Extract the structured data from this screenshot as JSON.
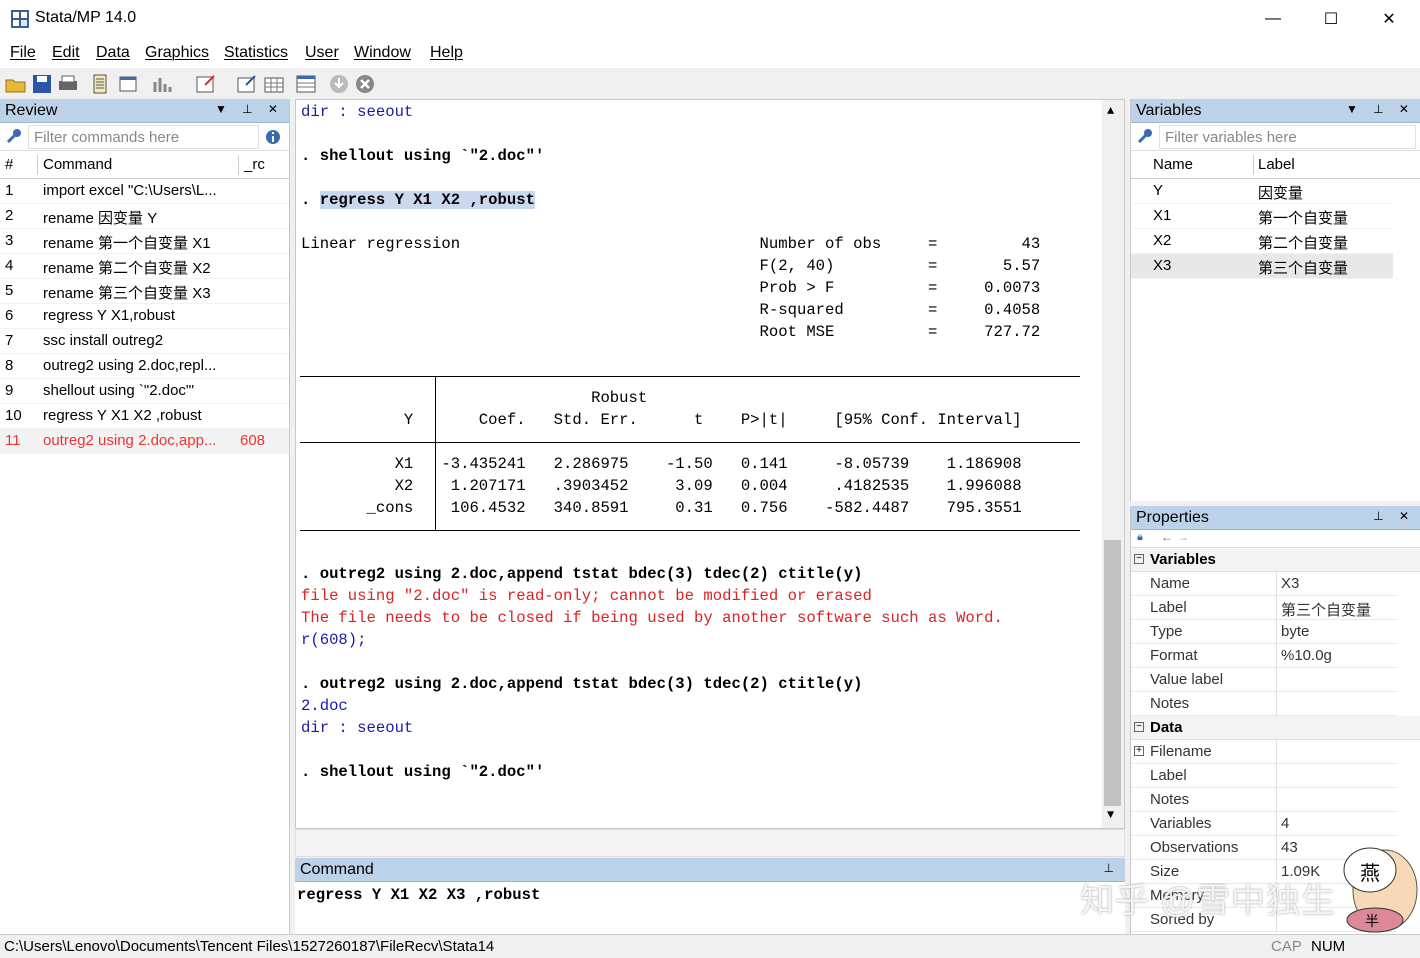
{
  "window": {
    "title": "Stata/MP 14.0",
    "min": "—",
    "max": "☐",
    "close": "✕"
  },
  "menu": [
    "File",
    "Edit",
    "Data",
    "Graphics",
    "Statistics",
    "User",
    "Window",
    "Help"
  ],
  "review": {
    "title": "Review",
    "filter_placeholder": "Filter commands here",
    "col_num": "#",
    "col_command": "Command",
    "col_rc": "_rc",
    "rows": [
      {
        "n": "1",
        "cmd": "import excel \"C:\\Users\\L...",
        "rc": "",
        "error": false
      },
      {
        "n": "2",
        "cmd": "rename 因变量 Y",
        "rc": "",
        "error": false
      },
      {
        "n": "3",
        "cmd": "rename 第一个自变量 X1",
        "rc": "",
        "error": false
      },
      {
        "n": "4",
        "cmd": "rename 第二个自变量 X2",
        "rc": "",
        "error": false
      },
      {
        "n": "5",
        "cmd": "rename 第三个自变量 X3",
        "rc": "",
        "error": false
      },
      {
        "n": "6",
        "cmd": "regress Y X1,robust",
        "rc": "",
        "error": false
      },
      {
        "n": "7",
        "cmd": "ssc install outreg2",
        "rc": "",
        "error": false
      },
      {
        "n": "8",
        "cmd": "outreg2 using 2.doc,repl...",
        "rc": "",
        "error": false
      },
      {
        "n": "9",
        "cmd": "shellout using `\"2.doc\"'",
        "rc": "",
        "error": false
      },
      {
        "n": "10",
        "cmd": "regress Y X1 X2 ,robust",
        "rc": "",
        "error": false
      },
      {
        "n": "11",
        "cmd": "outreg2 using 2.doc,app...",
        "rc": "608",
        "error": true
      }
    ]
  },
  "results": {
    "lines": [
      {
        "text": "dir : seeout",
        "cls": "blue"
      },
      {
        "text": "",
        "cls": ""
      },
      {
        "text": ". shellout using `\"2.doc\"'",
        "cls": "bold"
      },
      {
        "text": "",
        "cls": ""
      },
      {
        "text": ". regress Y X1 X2 ,robust",
        "cls": "bold hl"
      },
      {
        "text": "",
        "cls": ""
      },
      {
        "text": "Linear regression                                Number of obs     =         43",
        "cls": ""
      },
      {
        "text": "                                                 F(2, 40)          =       5.57",
        "cls": ""
      },
      {
        "text": "                                                 Prob > F          =     0.0073",
        "cls": ""
      },
      {
        "text": "                                                 R-squared         =     0.4058",
        "cls": ""
      },
      {
        "text": "                                                 Root MSE          =     727.72",
        "cls": ""
      },
      {
        "text": "",
        "cls": ""
      },
      {
        "text": "",
        "cls": ""
      },
      {
        "text": "                               Robust",
        "cls": ""
      },
      {
        "text": "           Y       Coef.   Std. Err.      t    P>|t|     [95% Conf. Interval]",
        "cls": ""
      },
      {
        "text": "",
        "cls": ""
      },
      {
        "text": "          X1   -3.435241   2.286975    -1.50   0.141     -8.05739    1.186908",
        "cls": ""
      },
      {
        "text": "          X2    1.207171   .3903452     3.09   0.004     .4182535    1.996088",
        "cls": ""
      },
      {
        "text": "       _cons    106.4532   340.8591     0.31   0.756    -582.4487    795.3551",
        "cls": ""
      },
      {
        "text": "",
        "cls": ""
      },
      {
        "text": "",
        "cls": ""
      },
      {
        "text": ". outreg2 using 2.doc,append tstat bdec(3) tdec(2) ctitle(y)",
        "cls": "bold"
      },
      {
        "text": "file using \"2.doc\" is read-only; cannot be modified or erased",
        "cls": "red"
      },
      {
        "text": "The file needs to be closed if being used by another software such as Word.",
        "cls": "red"
      },
      {
        "text": "r(608);",
        "cls": "blue"
      },
      {
        "text": "",
        "cls": ""
      },
      {
        "text": ". outreg2 using 2.doc,append tstat bdec(3) tdec(2) ctitle(y)",
        "cls": "bold"
      },
      {
        "text": "2.doc",
        "cls": "blue"
      },
      {
        "text": "dir : seeout",
        "cls": "blue"
      },
      {
        "text": "",
        "cls": ""
      },
      {
        "text": ". shellout using `\"2.doc\"'",
        "cls": "bold"
      },
      {
        "text": "",
        "cls": ""
      },
      {
        "text": "",
        "cls": ""
      },
      {
        "text": ".",
        "cls": ""
      }
    ]
  },
  "command": {
    "title": "Command",
    "value": "regress Y X1 X2 X3 ,robust"
  },
  "variables": {
    "title": "Variables",
    "filter_placeholder": "Filter variables here",
    "col_name": "Name",
    "col_label": "Label",
    "rows": [
      {
        "name": "Y",
        "label": "因变量"
      },
      {
        "name": "X1",
        "label": "第一个自变量"
      },
      {
        "name": "X2",
        "label": "第二个自变量"
      },
      {
        "name": "X3",
        "label": "第三个自变量"
      }
    ]
  },
  "properties": {
    "title": "Properties",
    "group_variables": "Variables",
    "var_props": [
      {
        "k": "Name",
        "v": "X3"
      },
      {
        "k": "Label",
        "v": "第三个自变量"
      },
      {
        "k": "Type",
        "v": "byte"
      },
      {
        "k": "Format",
        "v": "%10.0g"
      },
      {
        "k": "Value label",
        "v": ""
      },
      {
        "k": "Notes",
        "v": ""
      }
    ],
    "group_data": "Data",
    "data_props": [
      {
        "k": "Filename",
        "v": ""
      },
      {
        "k": "Label",
        "v": ""
      },
      {
        "k": "Notes",
        "v": ""
      },
      {
        "k": "Variables",
        "v": "4"
      },
      {
        "k": "Observations",
        "v": "43"
      },
      {
        "k": "Size",
        "v": "1.09K"
      },
      {
        "k": "Memory",
        "v": ""
      },
      {
        "k": "Sorted by",
        "v": ""
      }
    ]
  },
  "status": {
    "path": "C:\\Users\\Lenovo\\Documents\\Tencent Files\\1527260187\\FileRecv\\Stata14",
    "cap": "CAP",
    "num": "NUM"
  },
  "watermark": "知乎 @雪中独生"
}
